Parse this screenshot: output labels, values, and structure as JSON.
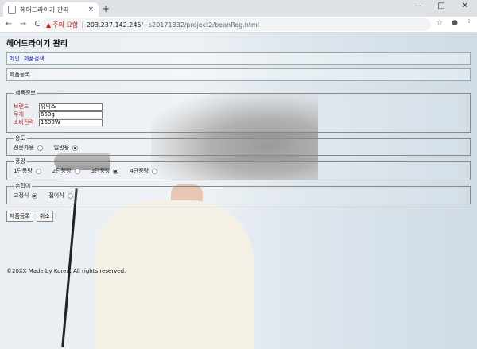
{
  "browser": {
    "tab_title": "헤어드라이기 관리",
    "tab_close": "×",
    "new_tab": "+",
    "win_min": "—",
    "win_max": "□",
    "win_close": "✕",
    "back": "←",
    "forward": "→",
    "reload": "C",
    "security_warning": "주의 요함",
    "url_host": "203.237.142.245",
    "url_path": "/~s20171332/project2/beanReg.html",
    "star": "☆",
    "profile": "●",
    "menu": "⋮"
  },
  "page": {
    "title": "헤어드라이기 관리",
    "menu": [
      "메인",
      "제품검색"
    ],
    "section": "제품등록"
  },
  "product_info": {
    "legend": "제품정보",
    "fields": [
      {
        "label": "브랜드",
        "value": "유닉스"
      },
      {
        "label": "무게",
        "value": "650g"
      },
      {
        "label": "소비전력",
        "value": "1600W"
      }
    ]
  },
  "usage": {
    "legend": "용도",
    "options": [
      {
        "label": "전문가용",
        "checked": false
      },
      {
        "label": "일반용",
        "checked": true
      }
    ]
  },
  "wind": {
    "legend": "풍량",
    "options": [
      {
        "label": "1단풍량",
        "checked": false
      },
      {
        "label": "2단풍량",
        "checked": false
      },
      {
        "label": "3단풍량",
        "checked": true
      },
      {
        "label": "4단풍량",
        "checked": false
      }
    ]
  },
  "handle": {
    "legend": "손잡이",
    "options": [
      {
        "label": "고정식",
        "checked": true
      },
      {
        "label": "접이식",
        "checked": false
      }
    ]
  },
  "buttons": {
    "submit": "제품등록",
    "cancel": "취소"
  },
  "footer": "©20XX Made by Korea. All rights reserved."
}
